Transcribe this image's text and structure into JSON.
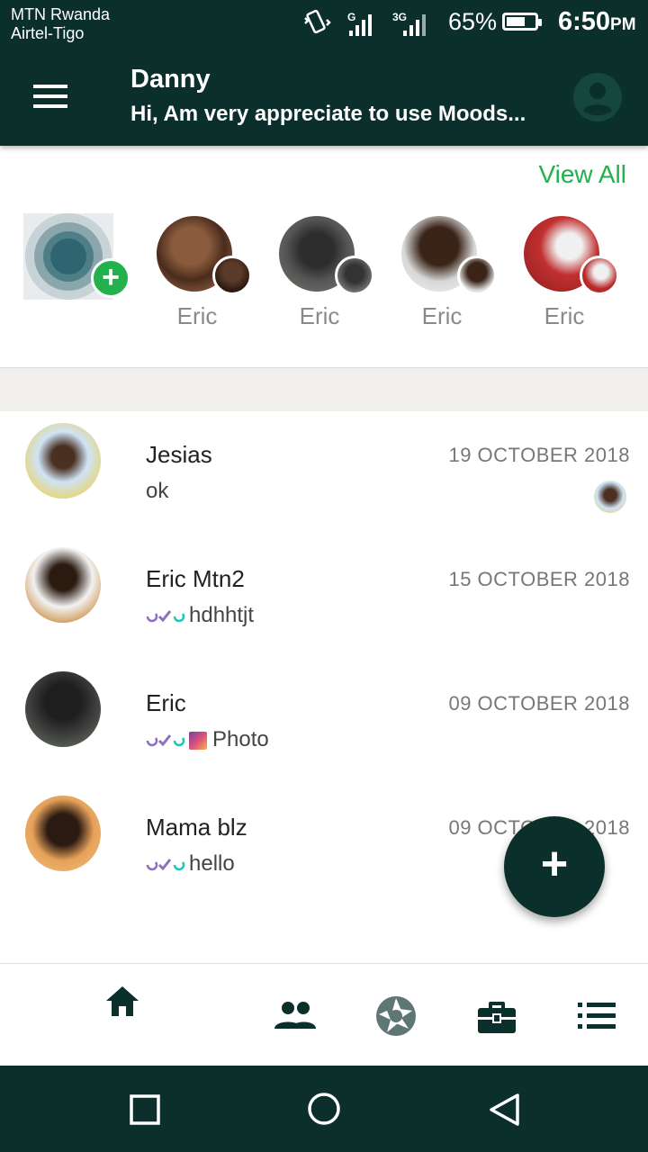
{
  "status_bar": {
    "carrier_1": "MTN Rwanda",
    "carrier_2": "Airtel-Tigo",
    "network_1": "G",
    "network_2": "3G",
    "battery": "65%",
    "battery_level": 0.65,
    "time": "6:50",
    "ampm": "PM"
  },
  "header": {
    "name": "Danny",
    "status": "Hi, Am very appreciate to use Moods..."
  },
  "stories": {
    "view_all": "View All",
    "items": [
      {
        "label": "Eric"
      },
      {
        "label": "Eric"
      },
      {
        "label": "Eric"
      },
      {
        "label": "Eric"
      }
    ]
  },
  "chats": [
    {
      "name": "Jesias",
      "date": "19 OCTOBER 2018",
      "message": "ok"
    },
    {
      "name": "Eric Mtn2",
      "date": "15 OCTOBER 2018",
      "message": "hdhhtjt"
    },
    {
      "name": "Eric",
      "date": "09 OCTOBER 2018",
      "message": "Photo"
    },
    {
      "name": "Mama blz",
      "date": "09 OCTOBER 2018",
      "message": "hello"
    }
  ],
  "icons": {
    "menu": "menu-icon",
    "profile": "account-circle-icon",
    "fab": "plus-icon",
    "nav": [
      "home-icon",
      "people-icon",
      "camera-aperture-icon",
      "briefcase-icon",
      "list-icon"
    ],
    "system": [
      "recents-square-icon",
      "home-circle-icon",
      "back-triangle-icon"
    ]
  },
  "colors": {
    "primary": "#0b302c",
    "accent": "#22b14c"
  }
}
